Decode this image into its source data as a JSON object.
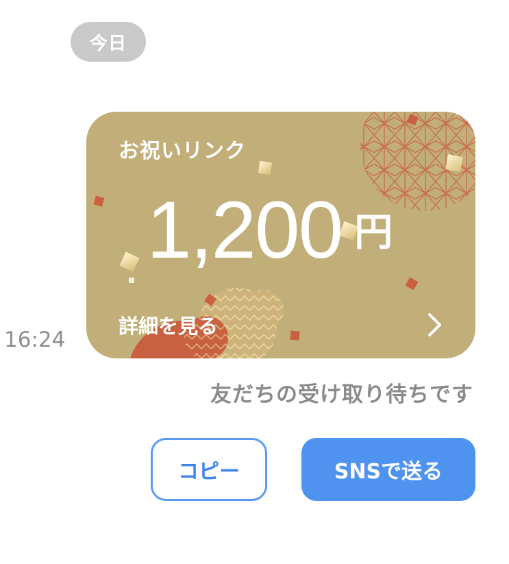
{
  "chat": {
    "date_label": "今日",
    "timestamp": "16:24",
    "status_text": "友だちの受け取り待ちです"
  },
  "gift_card": {
    "title": "お祝いリンク",
    "amount": "1,200",
    "currency_unit": "円",
    "details_label": "詳細を見る",
    "colors": {
      "background": "#c1ae79",
      "accent_red": "#c9603f",
      "gold": "#e7d39a"
    }
  },
  "actions": {
    "copy_label": "コピー",
    "send_sns_label": "SNSで送る",
    "colors": {
      "primary": "#4f93f0"
    }
  }
}
